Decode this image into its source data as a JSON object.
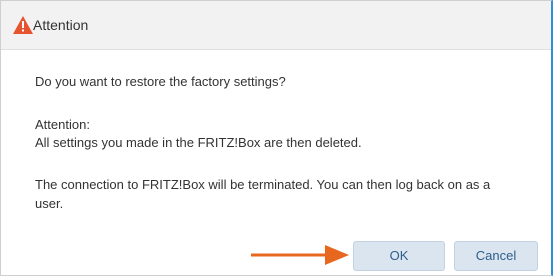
{
  "dialog": {
    "title": "Attention",
    "question": "Do you want to restore the factory settings?",
    "attention_label": "Attention:",
    "attention_detail": "All settings you made in the FRITZ!Box are then deleted.",
    "connection_line1": "The connection to FRITZ!Box will be terminated. You can then log back on as a",
    "connection_line2": "user."
  },
  "buttons": {
    "ok_label": "OK",
    "cancel_label": "Cancel"
  },
  "icons": {
    "title_icon": "warning-triangle-icon",
    "pointer": "arrow-right-icon"
  },
  "colors": {
    "warning": "#e8532f",
    "arrow": "#e8671e",
    "button_bg": "#dbe5ef",
    "button_text": "#2d5f8c",
    "accent_border": "#2e8fd6"
  }
}
